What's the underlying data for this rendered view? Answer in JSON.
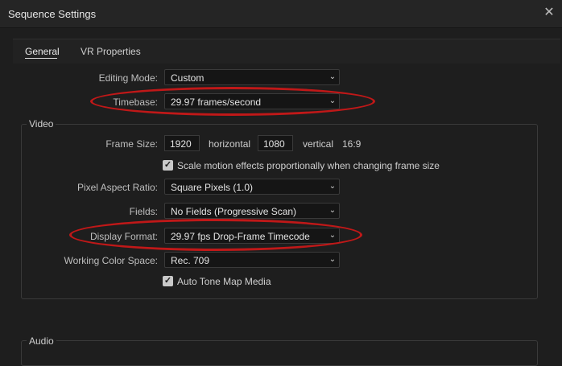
{
  "window": {
    "title": "Sequence Settings",
    "close_glyph": "✕"
  },
  "tabs": [
    {
      "label": "General"
    },
    {
      "label": "VR Properties"
    }
  ],
  "general": {
    "editing_mode": {
      "label": "Editing Mode:",
      "value": "Custom"
    },
    "timebase": {
      "label": "Timebase:",
      "value": "29.97  frames/second"
    }
  },
  "video": {
    "section_title": "Video",
    "frame_size": {
      "label": "Frame Size:",
      "width": "1920",
      "horizontal_label": "horizontal",
      "height": "1080",
      "vertical_label": "vertical",
      "aspect": "16:9"
    },
    "scale_motion": {
      "label": "Scale motion effects proportionally when changing frame size",
      "checked": true
    },
    "pixel_aspect_ratio": {
      "label": "Pixel Aspect Ratio:",
      "value": "Square Pixels (1.0)"
    },
    "fields": {
      "label": "Fields:",
      "value": "No Fields (Progressive Scan)"
    },
    "display_format": {
      "label": "Display Format:",
      "value": "29.97 fps Drop-Frame Timecode"
    },
    "working_color_space": {
      "label": "Working Color Space:",
      "value": "Rec. 709"
    },
    "auto_tone_map": {
      "label": "Auto Tone Map Media",
      "checked": true
    }
  },
  "audio": {
    "section_title": "Audio"
  },
  "icons": {
    "chevron": "chevron-down-icon",
    "check": "checkmark-icon"
  },
  "colors": {
    "annotation": "#c01818",
    "background": "#1e1e1e"
  },
  "glyphs": {
    "chevron": "⌄",
    "check": "✓"
  }
}
